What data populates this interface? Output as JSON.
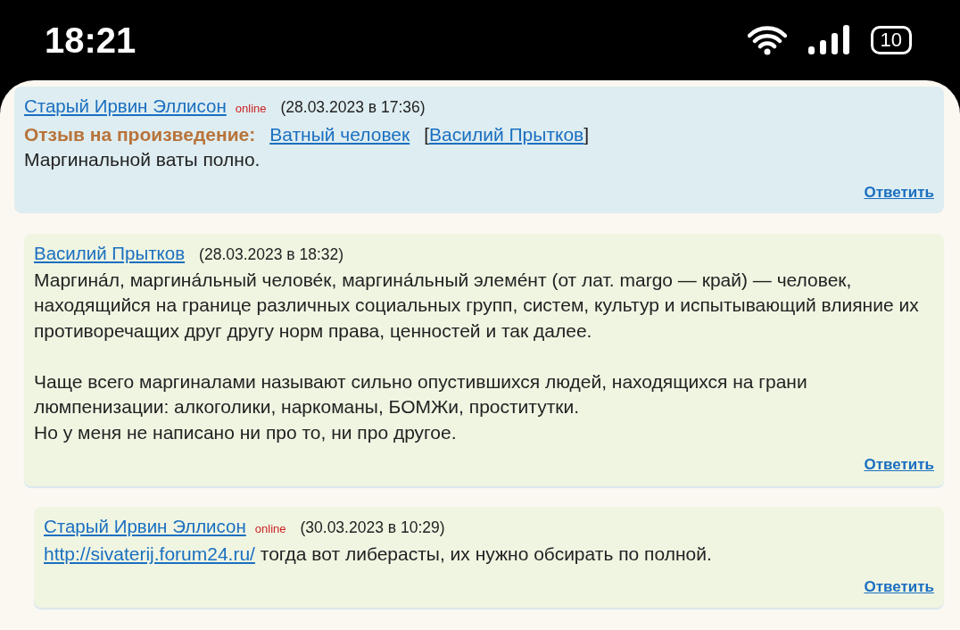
{
  "status_bar": {
    "time": "18:21",
    "battery": "10"
  },
  "comments": [
    {
      "author": "Старый Ирвин Эллисон",
      "presence": "online",
      "date": "(28.03.2023 в 17:36)",
      "color": "#deedf1",
      "review": {
        "label": "Отзыв на произведение:",
        "work": "Ватный человек",
        "open_bracket": "[",
        "work_author": "Василий Прытков",
        "close_bracket": "]"
      },
      "paragraphs": [
        [
          "Маргинальной ваты полно."
        ]
      ],
      "reply": "Ответить",
      "children": [
        {
          "author": "Василий Прытков",
          "date": "(28.03.2023 в 18:32)",
          "color": "#f0f5e2",
          "paragraphs": [
            [
              "Маргина́л, маргина́льный челове́к, маргина́льный элеме́нт (от лат. margo — край) — человек, находящийся на границе различных социальных групп, систем, культур и испытывающий влияние их противоречащих друг другу норм права, ценностей и так далее."
            ],
            [
              "Чаще всего маргиналами называют сильно опустившихся людей, находящихся на грани люмпенизации: алкоголики, наркоманы, БОМЖи, проститутки.",
              "Но у меня не написано ни про то, ни про другое."
            ]
          ],
          "reply": "Ответить",
          "children": [
            {
              "author": "Старый Ирвин Эллисон",
              "presence": "online",
              "date": "(30.03.2023 в 10:29)",
              "color": "#f0f5e2",
              "link": "http://sivaterij.forum24.ru/",
              "paragraphs": [
                [
                  "тогда вот либерасты, их нужно обсирать по полной."
                ]
              ],
              "reply": "Ответить"
            }
          ]
        }
      ]
    }
  ]
}
